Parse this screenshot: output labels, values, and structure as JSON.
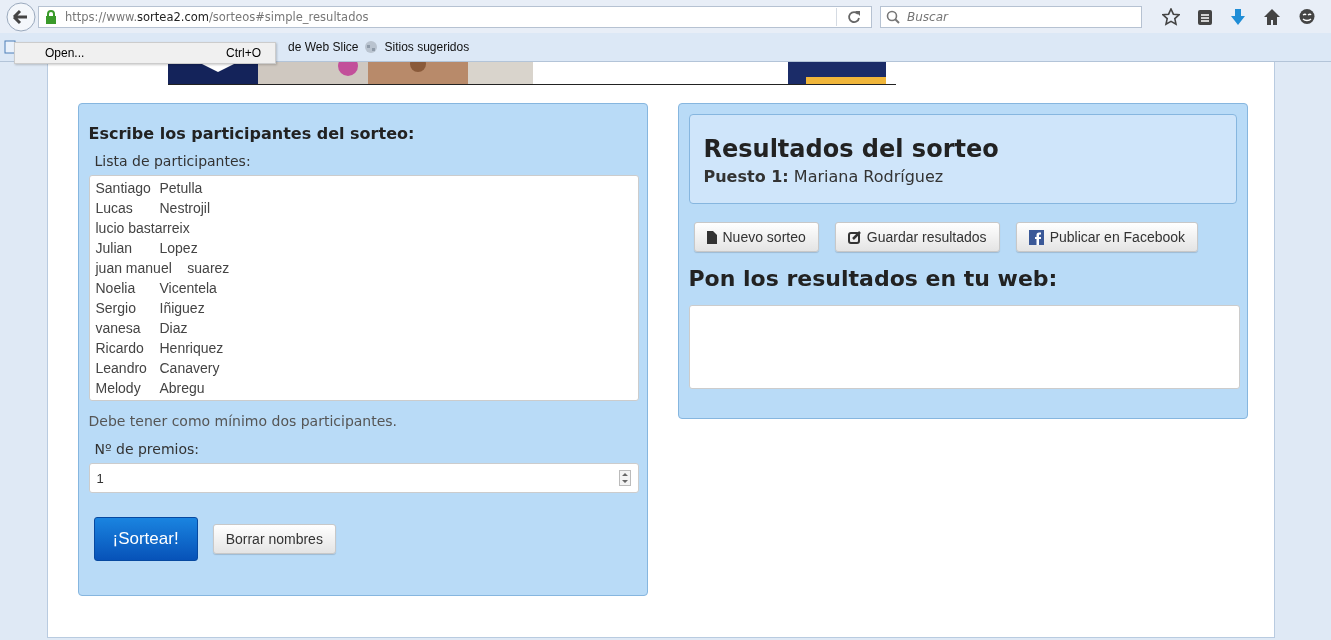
{
  "browser": {
    "url_host": "https://www.",
    "url_domain": "sortea2.com",
    "url_path": "/sorteos#simple_resultados",
    "search_placeholder": "Buscar"
  },
  "bookmarks": [
    "de Web Slice",
    "Sitios sugeridos"
  ],
  "context_menu": {
    "label": "Open...",
    "shortcut": "Ctrl+O"
  },
  "banner": {
    "kind": "picture"
  },
  "participants_panel": {
    "title": "Escribe los participantes del sorteo:",
    "list_label": "Lista de participantes:",
    "lines": [
      "Santiago\tPetulla",
      "Lucas\tNestrojil",
      "lucio bastarreix",
      "Julian\tLopez",
      "juan manuel    suarez",
      "Noelia\tVicentela",
      "Sergio\tIñiguez",
      "vanesa\tDiaz",
      "Ricardo\tHenriquez",
      "Leandro\tCanavery",
      "Melody\tAbregu"
    ],
    "hint": "Debe tener como mínimo dos participantes.",
    "prizes_label": "Nº de premios:",
    "prizes_value": "1",
    "buttons": [
      {
        "label": "¡Sortear!",
        "kind": "primary"
      },
      {
        "label": "Borrar nombres",
        "kind": "default"
      }
    ]
  },
  "results_panel": {
    "title": "Resultados del sorteo",
    "result": "**Puesto 1:** Mariana Rodríguez",
    "buttons": [
      {
        "label": "Nuevo sorteo",
        "kind": "file"
      },
      {
        "label": "Guardar resultados",
        "kind": "edit"
      },
      {
        "label": "Publicar en Facebook",
        "kind": "facebook"
      }
    ],
    "embed_title": "Pon los resultados en tu web:"
  }
}
